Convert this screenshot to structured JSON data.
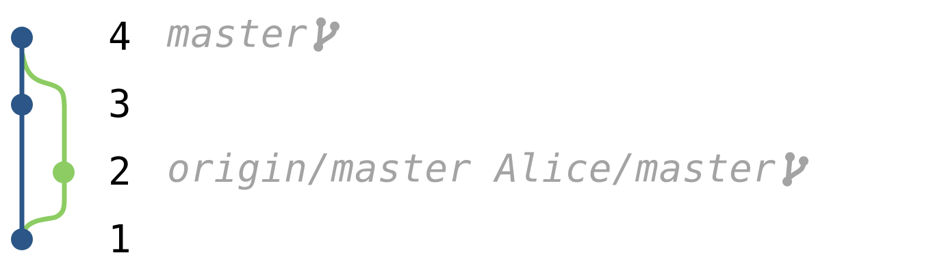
{
  "colors": {
    "main_line": "#2b5687",
    "side_branch": "#8ccc63",
    "label_text": "#a3a3a3",
    "number_text": "#000000"
  },
  "commits": [
    {
      "number": "4",
      "lane": "main",
      "refs": "master",
      "icon": "branch-icon"
    },
    {
      "number": "3",
      "lane": "main",
      "refs": "",
      "icon": ""
    },
    {
      "number": "2",
      "lane": "side",
      "refs": "origin/master Alice/master",
      "icon": "branch-icon"
    },
    {
      "number": "1",
      "lane": "main",
      "refs": "",
      "icon": ""
    }
  ]
}
